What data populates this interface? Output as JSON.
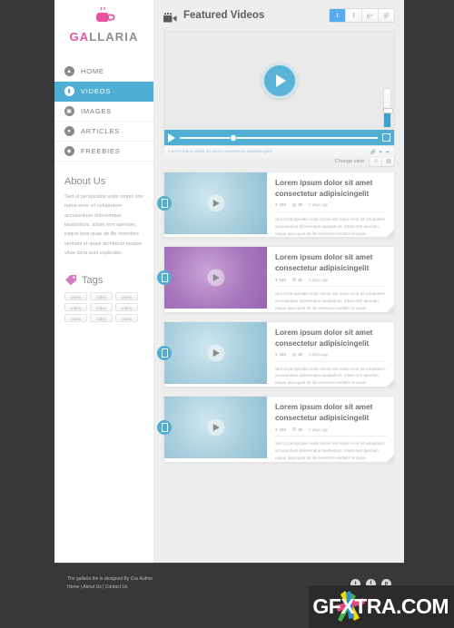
{
  "brand": {
    "pink_part": "GA",
    "gray_part": "LLARIA",
    "logo_icon": "coffee-cup-icon",
    "accent": "#e8539f"
  },
  "sidebar": {
    "nav": [
      {
        "label": "HOME",
        "icon": "home-icon",
        "active": false
      },
      {
        "label": "VIDEOS",
        "icon": "video-icon",
        "active": true
      },
      {
        "label": "IMAGES",
        "icon": "image-icon",
        "active": false
      },
      {
        "label": "ARTICLES",
        "icon": "article-icon",
        "active": false
      },
      {
        "label": "FREEBIES",
        "icon": "gift-icon",
        "active": false
      }
    ],
    "about": {
      "heading": "About Us",
      "body": "Sed ut perspiciatis unde omnis iste natus error sit voluptatem accusantium doloremque laudantium, totam rem aperiam, eaque ipsa quae ab illo inventore veritatis et quasi architecto beatae vitae dicta sunt explicabo."
    },
    "tags": {
      "heading": "Tags",
      "icon": "tag-icon",
      "items": [
        "Video",
        "Video",
        "Video",
        "Video",
        "Video",
        "Video",
        "Video",
        "Video",
        "Video"
      ]
    }
  },
  "header": {
    "icon": "video-camera-icon",
    "title": "Featured Videos",
    "social": [
      {
        "name": "twitter",
        "glyph": "t",
        "active": true
      },
      {
        "name": "facebook",
        "glyph": "f",
        "active": false
      },
      {
        "name": "googleplus",
        "glyph": "g+",
        "active": false
      },
      {
        "name": "rss",
        "glyph": "@",
        "active": false
      }
    ]
  },
  "player": {
    "play_label": "play",
    "caption": "Lorem ipsum dolor sit amet consectetur adipisicingelit",
    "caption_icons": [
      "link-icon",
      "heart-icon",
      "share-icon"
    ],
    "progress_percent": 27,
    "volume_percent": 40
  },
  "view_switch": {
    "label": "Change view",
    "options": [
      {
        "name": "list-view",
        "glyph": "≡",
        "active": true
      },
      {
        "name": "grid-view",
        "glyph": "▦",
        "active": false
      }
    ]
  },
  "videos": [
    {
      "title": "Lorem ipsum dolor sit amet consectetur adipisicingelit",
      "likes": "150",
      "comments": "30",
      "time": "3 days ago",
      "description": "Sed ut perspiciatis unde omnis iste natus error sit voluptatem accusantium doloremque laudantium, totam rem aperiam, eaque ipsa quae ab illo inventore veritatis et quasi",
      "thumb_color": "blue"
    },
    {
      "title": "Lorem ipsum dolor sit amet consectetur adipisicingelit",
      "likes": "150",
      "comments": "30",
      "time": "3 days ago",
      "description": "Sed ut perspiciatis unde omnis iste natus error sit voluptatem accusantium doloremque laudantium, totam rem aperiam, eaque ipsa quae ab illo inventore veritatis et quasi",
      "thumb_color": "purple"
    },
    {
      "title": "Lorem ipsum dolor sit amet consectetur adipisicingelit",
      "likes": "150",
      "comments": "30",
      "time": "3 days ago",
      "description": "Sed ut perspiciatis unde omnis iste natus error sit voluptatem accusantium doloremque laudantium, totam rem aperiam, eaque ipsa quae ab illo inventore veritatis et quasi",
      "thumb_color": "blue"
    },
    {
      "title": "Lorem ipsum dolor sit amet consectetur adipisicingelit",
      "likes": "150",
      "comments": "30",
      "time": "3 days ago",
      "description": "Sed ut perspiciatis unde omnis iste natus error sit voluptatem accusantium doloremque laudantium, totam rem aperiam, eaque ipsa quae ab illo inventore veritatis et quasi",
      "thumb_color": "blue"
    }
  ],
  "footer": {
    "credit": "The gallaria the  is designed  By  Css Author",
    "links": "Home | About Us | Contact Us",
    "social": [
      {
        "name": "twitter",
        "glyph": "t"
      },
      {
        "name": "facebook",
        "glyph": "f"
      },
      {
        "name": "pinterest",
        "glyph": "p"
      }
    ]
  },
  "watermark": {
    "text": "GFXTRA.COM"
  },
  "colors": {
    "accent_blue": "#4eaed4",
    "brand_pink": "#e8539f",
    "page_bg": "#383838"
  }
}
